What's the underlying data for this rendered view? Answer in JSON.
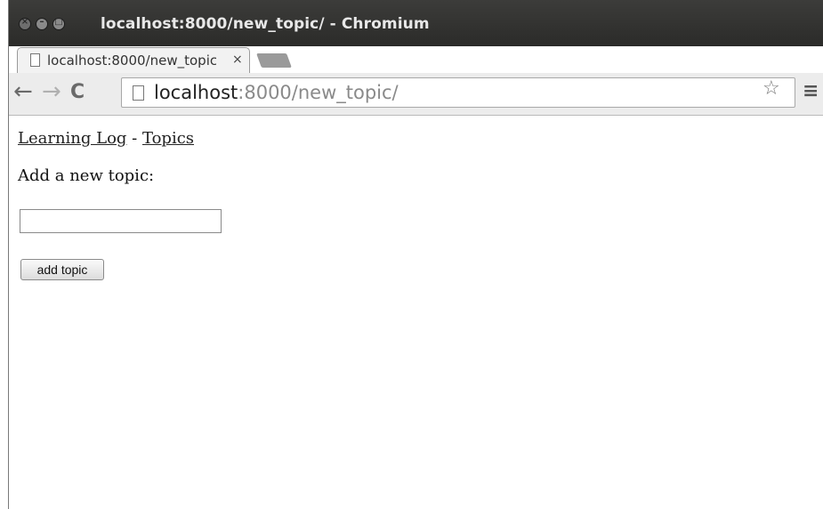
{
  "window": {
    "title": "localhost:8000/new_topic/ - Chromium"
  },
  "tab": {
    "title": "localhost:8000/new_topic/",
    "close_glyph": "×"
  },
  "toolbar": {
    "url_host": "localhost",
    "url_path": ":8000/new_topic/",
    "back_icon": "←",
    "forward_icon": "→",
    "reload_icon": "C",
    "star_icon": "☆",
    "menu_icon": "≡"
  },
  "page": {
    "home_link": "Learning Log",
    "separator": " - ",
    "topics_link": "Topics",
    "prompt": "Add a new topic:",
    "input_value": "",
    "submit_label": "add topic"
  }
}
